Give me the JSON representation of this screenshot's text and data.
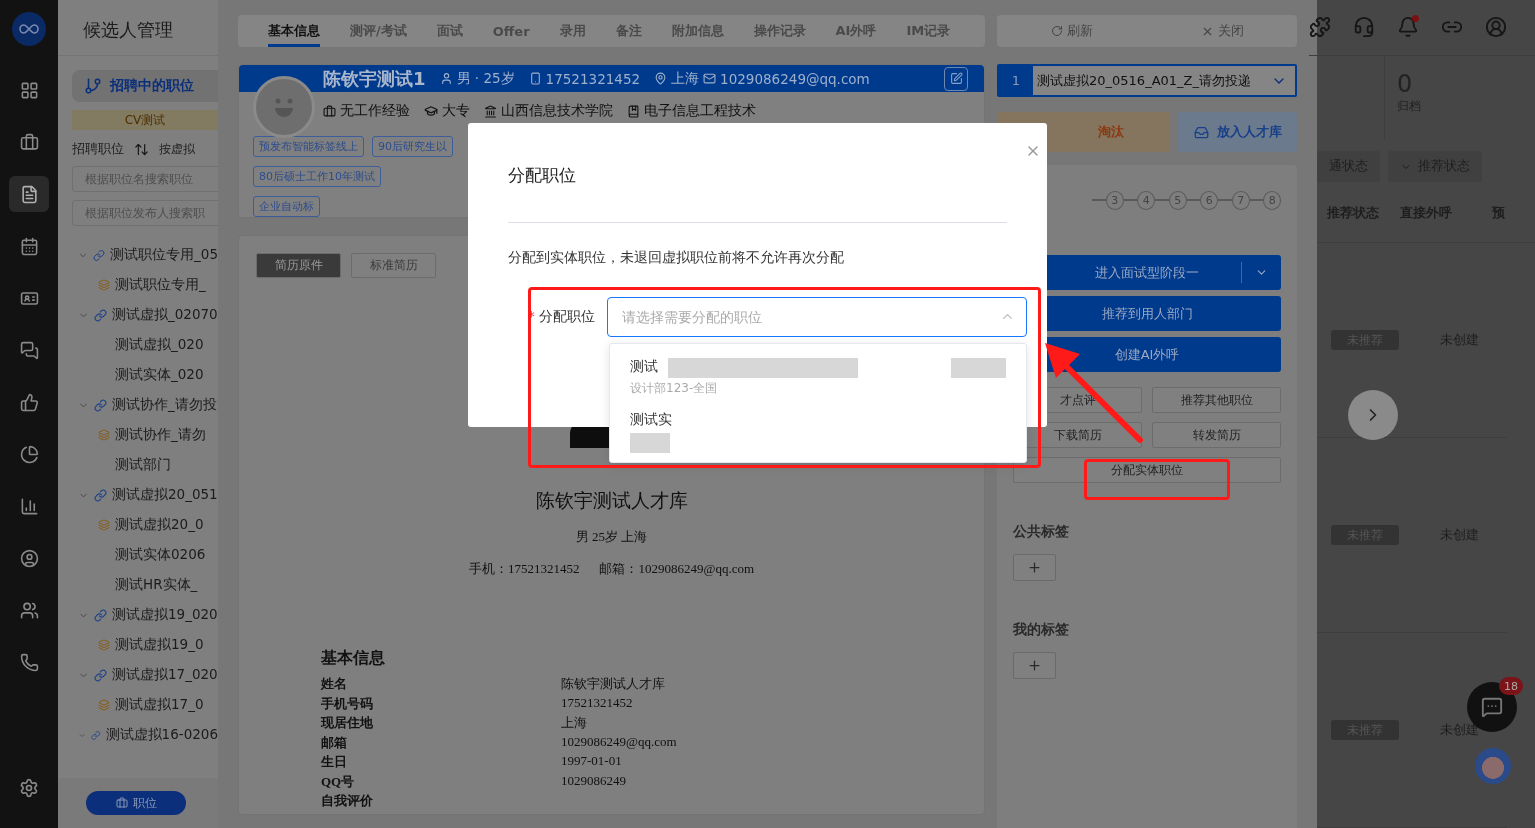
{
  "nav_rail": {
    "items": [
      {
        "selected": false
      },
      {
        "selected": false
      },
      {
        "selected": true
      },
      {
        "selected": false
      },
      {
        "selected": false
      },
      {
        "selected": false
      },
      {
        "selected": false
      },
      {
        "selected": false
      },
      {
        "selected": false
      },
      {
        "selected": false
      },
      {
        "selected": false
      },
      {
        "selected": false
      }
    ]
  },
  "left_panel": {
    "title": "候选人管理",
    "status_filter": "招聘中的职位",
    "banner": "CV测试",
    "section_label": "招聘职位",
    "sort_label": "按虚拟",
    "search_fields": [
      {
        "placeholder": "根据职位名搜索职位"
      },
      {
        "placeholder": "根据职位发布人搜索职"
      }
    ],
    "tree": [
      {
        "label": "测试职位专用_05",
        "expanded": true,
        "children": [
          {
            "label": "测试职位专用_",
            "kind": "stacked"
          }
        ]
      },
      {
        "label": "测试虚拟_02070",
        "expanded": true,
        "children": [
          {
            "label": "测试虚拟_020",
            "kind": "plain"
          },
          {
            "label": "测试实体_020",
            "kind": "plain"
          }
        ]
      },
      {
        "label": "测试协作_请勿投",
        "expanded": true,
        "children": [
          {
            "label": "测试协作_请勿",
            "kind": "stacked"
          },
          {
            "label": "测试部门",
            "kind": "plain"
          }
        ]
      },
      {
        "label": "测试虚拟20_051",
        "expanded": true,
        "children": [
          {
            "label": "测试虚拟20_0",
            "kind": "stacked"
          },
          {
            "label": "测试实体0206",
            "kind": "plain"
          },
          {
            "label": "测试HR实体_",
            "kind": "plain"
          }
        ]
      },
      {
        "label": "测试虚拟19_020",
        "expanded": true,
        "children": [
          {
            "label": "测试虚拟19_0",
            "kind": "stacked"
          }
        ]
      },
      {
        "label": "测试虚拟17_020",
        "expanded": true,
        "children": [
          {
            "label": "测试虚拟17_0",
            "kind": "stacked"
          }
        ]
      },
      {
        "label": "测试虚拟16-0206",
        "expanded": true
      }
    ],
    "bottom_button": "职位"
  },
  "tabs": [
    {
      "label": "基本信息",
      "selected": true
    },
    {
      "label": "测评/考试",
      "selected": false
    },
    {
      "label": "面试",
      "selected": false
    },
    {
      "label": "Offer",
      "selected": false
    },
    {
      "label": "录用",
      "selected": false
    },
    {
      "label": "备注",
      "selected": false
    },
    {
      "label": "附加信息",
      "selected": false
    },
    {
      "label": "操作记录",
      "selected": false
    },
    {
      "label": "AI外呼",
      "selected": false
    },
    {
      "label": "IM记录",
      "selected": false
    }
  ],
  "profile": {
    "name": "陈钦宇测试1",
    "gender_age": "男 · 25岁",
    "phone": "17521321452",
    "location": "上海",
    "email": "1029086249@qq.com",
    "experience": "无工作经验",
    "education": "大专",
    "school": "山西信息技术学院",
    "major": "电子信息工程技术",
    "tags": [
      "预发布智能标签线上",
      "90后研究生以",
      "80后硕士工作10年测试",
      "企业自动标"
    ]
  },
  "resume": {
    "view_buttons": [
      {
        "label": "简历原件",
        "selected": true
      },
      {
        "label": "标准简历",
        "selected": false
      }
    ],
    "title": "陈钦宇测试人才库",
    "summary": "男 25岁 上海",
    "contact": [
      "手机：17521321452",
      "邮箱：1029086249@qq.com"
    ],
    "section_title": "基本信息",
    "fields": [
      {
        "label": "姓名",
        "value": "陈钦宇测试人才库"
      },
      {
        "label": "手机号码",
        "value": "17521321452"
      },
      {
        "label": "现居住地",
        "value": "上海"
      },
      {
        "label": "邮箱",
        "value": "1029086249@qq.com"
      },
      {
        "label": "生日",
        "value": "1997-01-01"
      },
      {
        "label": "QQ号",
        "value": "1029086249"
      },
      {
        "label": "自我评价"
      }
    ]
  },
  "right_panel": {
    "toolbar": [
      "刷新",
      "关闭"
    ],
    "position_select": {
      "index": "1",
      "value": "测试虚拟20_0516_A01_Z_请勿投递"
    },
    "eliminate": "淘汰",
    "talent_pool": "放入人才库",
    "steps": [
      "3",
      "4",
      "5",
      "6",
      "7",
      "8"
    ],
    "primary_actions": [
      {
        "label": "进入面试型阶段一",
        "kind": "split"
      },
      {
        "label": "推荐到用人部门",
        "kind": "plain"
      },
      {
        "label": "创建AI外呼",
        "kind": "plain"
      }
    ],
    "secondary_actions": [
      {
        "label": "才点评",
        "kind": "half"
      },
      {
        "label": "推荐其他职位",
        "kind": "half"
      },
      {
        "label": "下载简历",
        "kind": "half"
      },
      {
        "label": "转发简历",
        "kind": "half"
      },
      {
        "label": "分配实体职位",
        "kind": "full"
      }
    ],
    "tag_sections": [
      "公共标签",
      "我的标签"
    ]
  },
  "header_icons": {
    "notifications_unread": true
  },
  "far_right": {
    "stat": {
      "value": "0",
      "label": "归档"
    },
    "filters": [
      "通状态",
      "推荐状态"
    ],
    "columns": [
      "推荐状态",
      "直接外呼",
      "预"
    ],
    "rows": [
      {
        "status": "未推荐",
        "call": "未创建"
      },
      {
        "status": "未推荐",
        "call": "未创建"
      },
      {
        "status": "未推荐",
        "call": "未创建"
      }
    ],
    "chat_badge": "18"
  },
  "modal": {
    "title": "分配职位",
    "description": "分配到实体职位，未退回虚拟职位前将不允许再次分配",
    "field": {
      "label": "分配职位",
      "required": true,
      "required_mark": "*",
      "placeholder": "请选择需要分配的职位",
      "expanded": true
    },
    "options": [
      {
        "title": "测试",
        "subtitle": "设计部123-全国"
      },
      {
        "title": "测试实"
      }
    ]
  }
}
